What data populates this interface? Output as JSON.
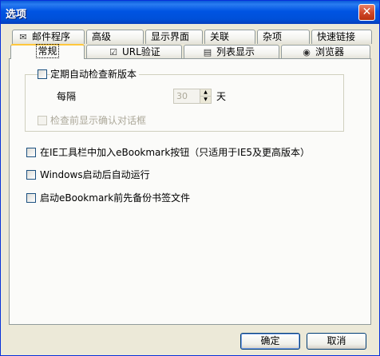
{
  "window": {
    "title": "选项",
    "close_glyph": "✕"
  },
  "tabs": {
    "row1": [
      {
        "label": "邮件程序",
        "icon": "envelope-icon",
        "glyph": "✉"
      },
      {
        "label": "高级"
      },
      {
        "label": "显示界面"
      },
      {
        "label": "关联"
      },
      {
        "label": "杂项"
      },
      {
        "label": "快速链接"
      }
    ],
    "row2": [
      {
        "label": "常规",
        "active": true
      },
      {
        "label": "URL验证",
        "icon": "check-icon",
        "glyph": "☑"
      },
      {
        "label": "列表显示",
        "icon": "list-icon",
        "glyph": "▤"
      },
      {
        "label": "浏览器",
        "icon": "browser-icon",
        "glyph": "◉"
      }
    ]
  },
  "general": {
    "auto_check": {
      "label": "定期自动检查新版本",
      "checked": false
    },
    "interval_label": "每隔",
    "interval_value": "30",
    "interval_unit": "天",
    "confirm_before_check": {
      "label": "检查前显示确认对话框",
      "checked": false,
      "disabled": true
    },
    "ie_toolbar": {
      "label": "在IE工具栏中加入eBookmark按钮（只适用于IE5及更高版本）",
      "checked": false
    },
    "windows_startup": {
      "label": "Windows启动后自动运行",
      "checked": false
    },
    "backup_on_start": {
      "label": "启动eBookmark前先备份书签文件",
      "checked": false
    }
  },
  "buttons": {
    "ok": "确定",
    "cancel": "取消"
  },
  "colors": {
    "titlebar": "#0054e3",
    "dialog_bg": "#ece9d8",
    "panel_bg": "#fbfbf9",
    "active_tab_accent": "#ffc73c"
  }
}
